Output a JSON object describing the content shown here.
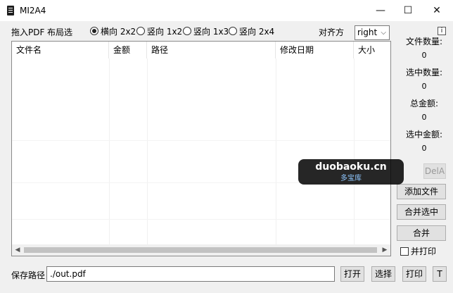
{
  "window": {
    "title": "MI2A4",
    "controls": {
      "minimize": "—",
      "maximize": "☐",
      "close": "✕"
    }
  },
  "toolbar": {
    "drag_label": "拖入PDF",
    "layout_label": "布局选",
    "layouts": [
      {
        "label": "横向 2x2",
        "selected": true
      },
      {
        "label": "竖向 1x2",
        "selected": false
      },
      {
        "label": "竖向 1x3",
        "selected": false
      },
      {
        "label": "竖向 2x4",
        "selected": false
      }
    ],
    "align_label": "对齐方",
    "align_value": "right",
    "info_label": "i"
  },
  "table": {
    "columns": [
      "文件名",
      "金额",
      "路径",
      "修改日期",
      "大小"
    ],
    "rows": []
  },
  "side": {
    "file_count_label": "文件数量:",
    "file_count": "0",
    "selected_count_label": "选中数量:",
    "selected_count": "0",
    "total_amount_label": "总金额:",
    "total_amount": "0",
    "selected_amount_label": "选中金额:",
    "selected_amount": "0",
    "del_all_label": "DelA",
    "add_file_label": "添加文件",
    "merge_selected_label": "合并选中",
    "merge_label": "合并",
    "merge_print_label": "并打印"
  },
  "bottom": {
    "save_path_label": "保存路径",
    "save_path_value": "./out.pdf",
    "open_label": "打开",
    "choose_label": "选择",
    "print_label": "打印",
    "t_label": "T"
  },
  "watermark": {
    "main": "duobaoku.cn",
    "sub": "多宝库"
  }
}
